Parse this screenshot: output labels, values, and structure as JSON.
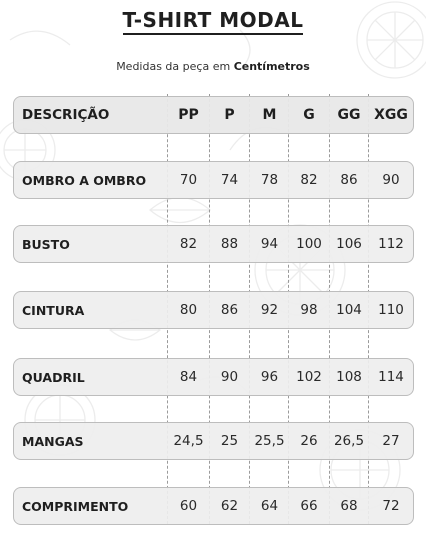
{
  "title": "T-SHIRT MODAL",
  "subtitle": {
    "prefix": "Medidas da peça em",
    "unit": "Centímetros"
  },
  "table": {
    "header": {
      "label": "DESCRIÇÃO",
      "sizes": [
        "PP",
        "P",
        "M",
        "G",
        "GG",
        "XGG"
      ]
    },
    "rows": [
      {
        "label": "OMBRO A OMBRO",
        "values": [
          "70",
          "74",
          "78",
          "82",
          "86",
          "90"
        ]
      },
      {
        "label": "BUSTO",
        "values": [
          "82",
          "88",
          "94",
          "100",
          "106",
          "112"
        ]
      },
      {
        "label": "CINTURA",
        "values": [
          "80",
          "86",
          "92",
          "98",
          "104",
          "110"
        ]
      },
      {
        "label": "QUADRIL",
        "values": [
          "84",
          "90",
          "96",
          "102",
          "108",
          "114"
        ]
      },
      {
        "label": "MANGAS",
        "values": [
          "24,5",
          "25",
          "25,5",
          "26",
          "26,5",
          "27"
        ]
      },
      {
        "label": "COMPRIMENTO",
        "values": [
          "60",
          "62",
          "64",
          "66",
          "68",
          "72"
        ]
      }
    ]
  },
  "colors": {
    "row_bg": "#eeeeee",
    "row_border": "#bdbdbd",
    "text": "#1f1f1f",
    "background_art": "#ececec"
  }
}
